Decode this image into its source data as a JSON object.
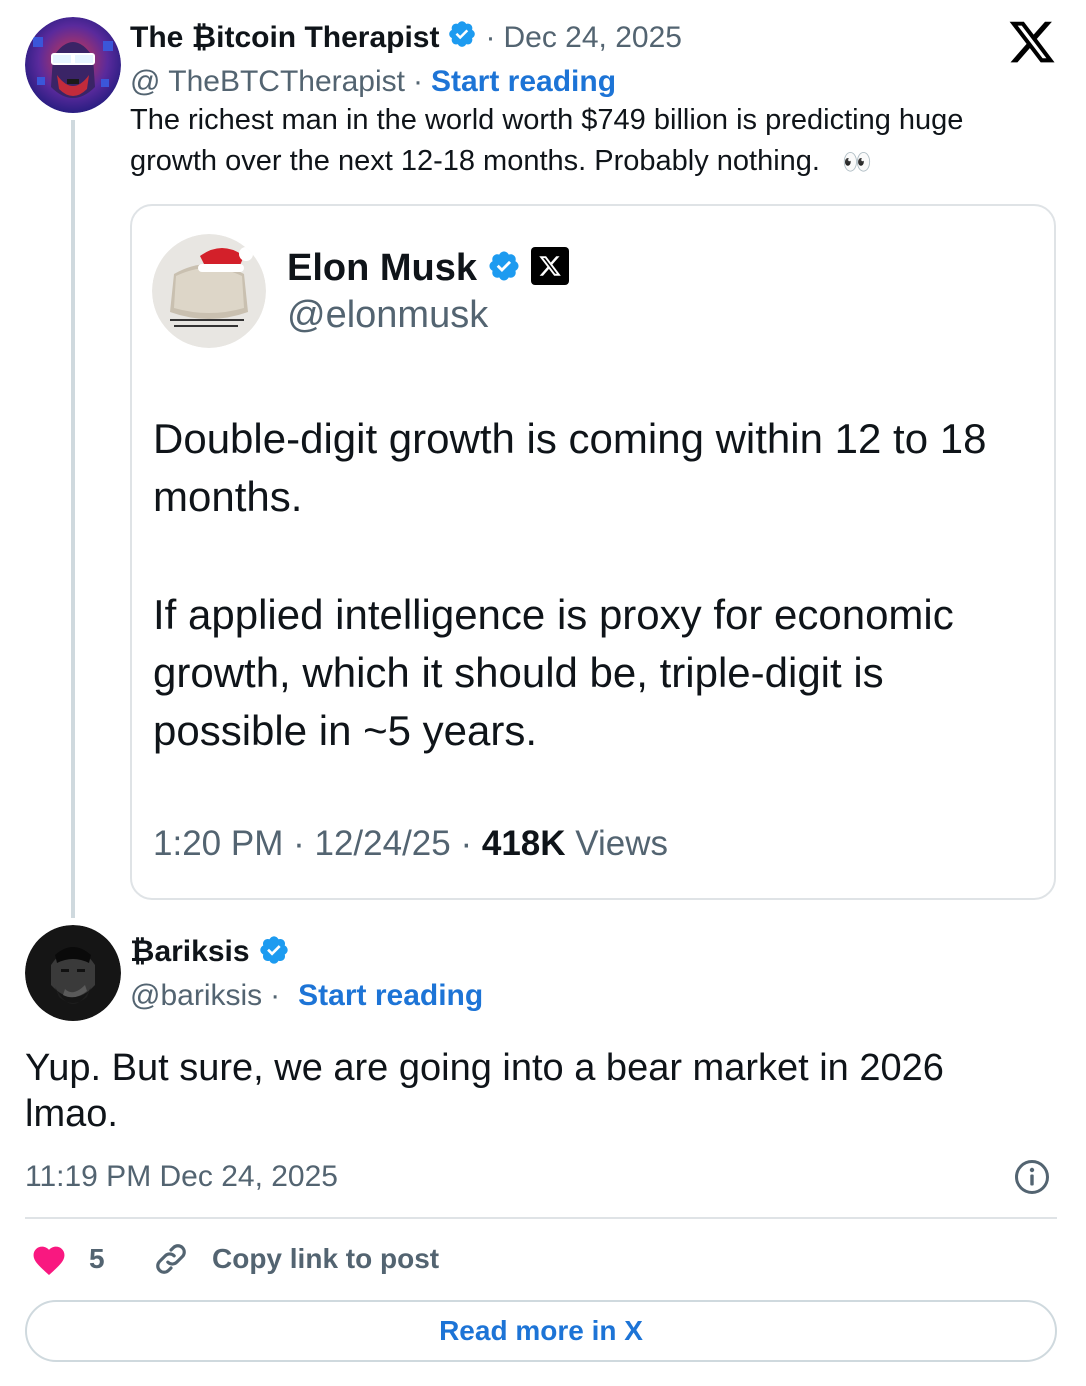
{
  "parent_tweet": {
    "display_name": "The ₿itcoin Therapist",
    "separator": "·",
    "date": "Dec 24, 2025",
    "handle": "@ TheBTCTherapist",
    "handle_separator": "·",
    "start_reading_label": "Start reading",
    "text": "The richest man in the world worth $749 billion is predicting huge growth over the next 12-18 months. Probably nothing.",
    "emoji": "👀"
  },
  "quoted_tweet": {
    "display_name": "Elon Musk",
    "handle": "@elonmusk",
    "paragraph_1": "Double-digit growth is coming within 12 to 18 months.",
    "paragraph_2": "If applied intelligence is proxy for economic growth, which it should be, triple-digit is possible in ~5 years.",
    "time": "1:20 PM",
    "meta_separator": "·",
    "date": "12/24/25",
    "views_count": "418K",
    "views_label": "Views"
  },
  "reply_tweet": {
    "display_name": "₿ariksis",
    "handle": "@bariksis",
    "handle_separator": "·",
    "start_reading_label": "Start reading",
    "text": "Yup. But sure, we are going into a bear market in 2026 lmao.",
    "timestamp": "11:19 PM Dec 24, 2025"
  },
  "actions": {
    "like_count": "5",
    "copy_link_label": "Copy link to post",
    "read_more_label": "Read more in X"
  },
  "colors": {
    "link_blue": "#1d74d6",
    "verified_blue": "#1d9bf0",
    "like_pink": "#f91880",
    "muted_gray": "#536471"
  },
  "icons": {
    "brand": "x-logo-icon",
    "verified": "verified-badge-icon",
    "info": "info-icon",
    "like": "heart-icon",
    "link": "link-icon"
  }
}
